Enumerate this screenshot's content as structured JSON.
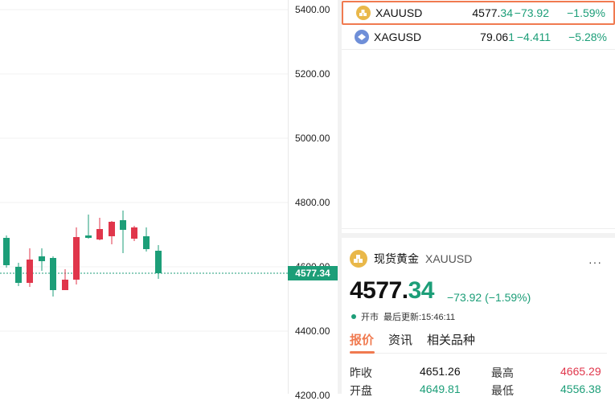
{
  "chart": {
    "y_ticks": [
      "5400.00",
      "5200.00",
      "5000.00",
      "4800.00",
      "4600.00",
      "4400.00",
      "4200.00"
    ],
    "current_price_label": "4577.34"
  },
  "watchlist": [
    {
      "symbol": "XAUUSD",
      "last_main": "4577.",
      "last_frac": "34",
      "change": "−73.92",
      "percent": "−1.59%",
      "selected": true,
      "icon": "gold-bars-icon"
    },
    {
      "symbol": "XAGUSD",
      "last_main": "79.06",
      "last_frac": "1",
      "change": "−4.411",
      "percent": "−5.28%",
      "selected": false,
      "icon": "silver-icon"
    }
  ],
  "detail": {
    "name": "现货黄金",
    "symbol": "XAUUSD",
    "more": "···",
    "price_main": "4577.",
    "price_frac": "34",
    "change_text": "−73.92 (−1.59%)",
    "status": "开市",
    "updated": "最后更新:15:46:11",
    "tabs": [
      "报价",
      "资讯",
      "相关品种"
    ],
    "quotes": {
      "prev_close_label": "昨收",
      "prev_close": "4651.26",
      "high_label": "最高",
      "high": "4665.29",
      "open_label": "开盘",
      "open": "4649.81",
      "low_label": "最低",
      "low": "4556.38"
    }
  },
  "colors": {
    "up": "#e0364b",
    "down": "#1c9e78",
    "accent": "#f07a50",
    "gold": "#e9b84a",
    "silver": "#6f8fd8"
  }
}
